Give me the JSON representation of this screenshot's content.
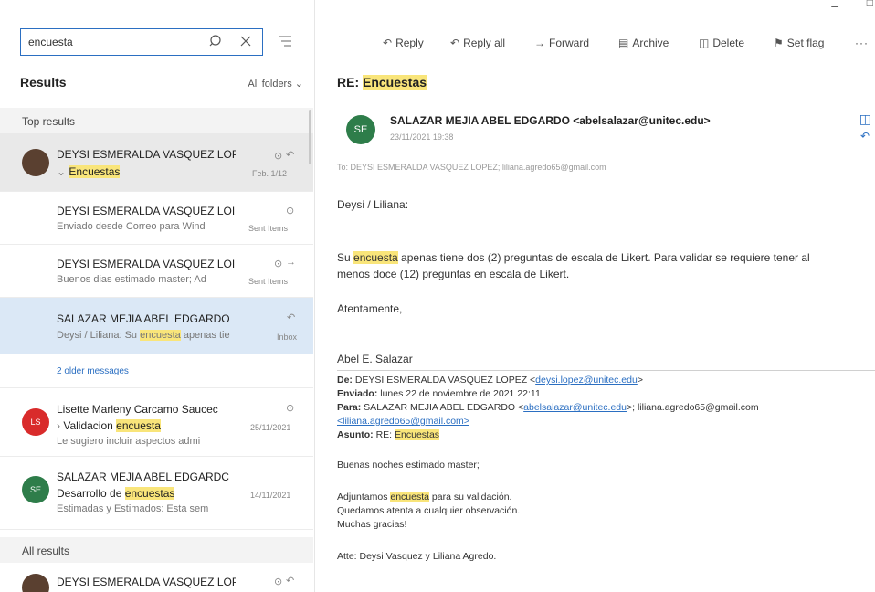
{
  "search": {
    "value": "encuesta"
  },
  "results": {
    "title": "Results",
    "folder_filter": "All folders"
  },
  "sections": {
    "top": "Top results",
    "all": "All results"
  },
  "list": [
    {
      "sender": "DEYSI ESMERALDA VASQUEZ LOPI",
      "subject": "Encuestas",
      "meta": "Feb. 1/12",
      "avatar_color": "#5a4030"
    },
    {
      "sender": "DEYSI ESMERALDA VASQUEZ LOI",
      "preview": "Enviado desde Correo para Wind",
      "meta": "Sent Items"
    },
    {
      "sender": "DEYSI ESMERALDA VASQUEZ LOI",
      "preview": "Buenos dias estimado master; Ad",
      "meta": "Sent Items"
    },
    {
      "sender": "SALAZAR MEJIA ABEL EDGARDO",
      "preview_a": "Deysi / Liliana: Su ",
      "preview_hl": "encuesta",
      "preview_b": " apenas tie",
      "meta": "Inbox"
    },
    {
      "sender": "Lisette Marleny Carcamo Saucec",
      "subject_a": "Validacion ",
      "subject_hl": "encuesta",
      "preview": "Le sugiero incluir aspectos admi",
      "meta": "25/11/2021",
      "avatar": "LS",
      "avatar_color": "#d92b2b"
    },
    {
      "sender": "SALAZAR MEJIA ABEL EDGARDC",
      "subject_a": "Desarrollo de ",
      "subject_hl": "encuestas",
      "preview": "Estimadas y Estimados: Esta sem",
      "meta": "14/11/2021",
      "avatar": "SE",
      "avatar_color": "#2e7d4a"
    },
    {
      "sender": "DEYSI ESMERALDA VASQUEZ LOPI"
    }
  ],
  "older_messages": "2 older messages",
  "toolbar": {
    "reply": "Reply",
    "reply_all": "Reply all",
    "forward": "Forward",
    "archive": "Archive",
    "delete": "Delete",
    "set_flag": "Set flag",
    "more": "···"
  },
  "email": {
    "subject_prefix": "RE: ",
    "subject_hl": "Encuestas",
    "sender_initials": "SE",
    "sender": "SALAZAR MEJIA ABEL EDGARDO <abelsalazar@unitec.edu>",
    "date": "23/11/2021 19:38",
    "to": "To: DEYSI ESMERALDA VASQUEZ LOPEZ; liliana.agredo65@gmail.com",
    "greeting": "Deysi / Liliana:",
    "p1_a": "Su ",
    "p1_hl": "encuesta",
    "p1_b": " apenas tiene dos (2) preguntas de escala de Likert. Para validar se requiere tener al",
    "p1_line2": "menos doce (12) preguntas en escala de Likert.",
    "closing": "Atentamente,",
    "signature": "Abel E. Salazar",
    "quoted": {
      "from_label": "De:",
      "from": " DEYSI ESMERALDA VASQUEZ LOPEZ <",
      "from_email": "deysi.lopez@unitec.edu",
      "from_end": ">",
      "sent_label": "Enviado:",
      "sent": " lunes 22 de noviembre de 2021 22:11",
      "to_label": "Para:",
      "to": " SALAZAR MEJIA ABEL EDGARDO <",
      "to_email": "abelsalazar@unitec.edu",
      "to_mid": ">; liliana.agredo65@gmail.com",
      "to_line2": "<liliana.agredo65@gmail.com>",
      "subject_label": "Asunto:",
      "subject_a": " RE: ",
      "subject_hl": "Encuestas",
      "greeting": "Buenas noches estimado master;",
      "line1_a": "Adjuntamos ",
      "line1_hl": "encuesta",
      "line1_b": " para su validación.",
      "line2": "Quedamos atenta a cualquier observación.",
      "line3": "Muchas gracias!",
      "sign": "Atte: Deysi Vasquez y Liliana Agredo."
    }
  },
  "colors": {
    "accent": "#2b6fc2",
    "highlight": "#f9e57a",
    "selected": "#dbe8f6"
  }
}
